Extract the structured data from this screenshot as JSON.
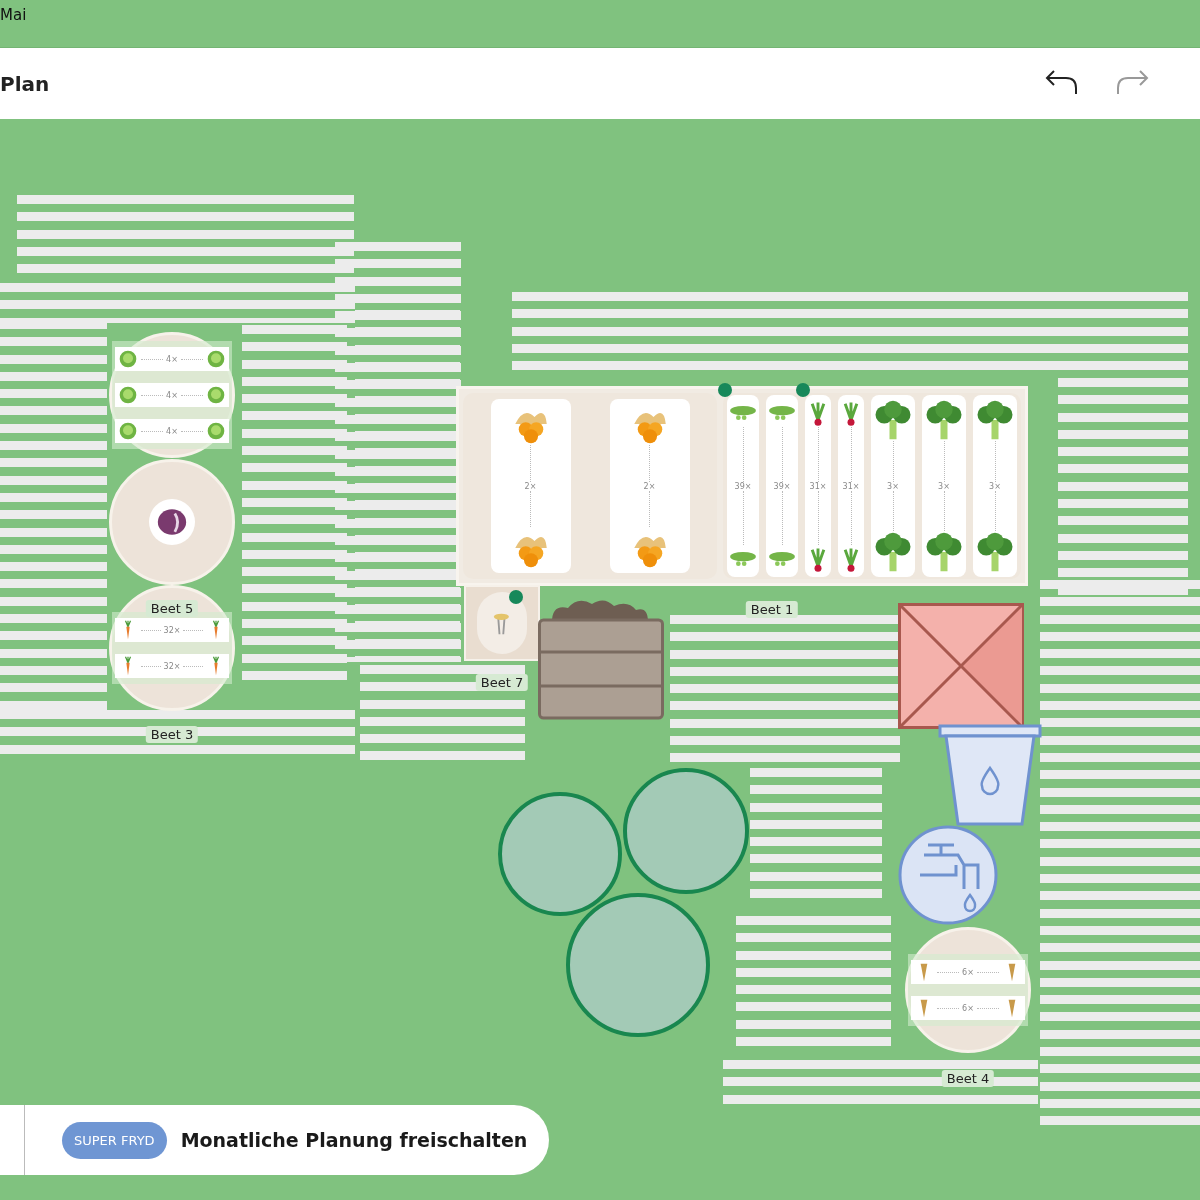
{
  "top_bar": {
    "month": "Mai"
  },
  "toolbar": {
    "title": "Plan",
    "undo": {
      "disabled": false
    },
    "redo": {
      "disabled": true
    }
  },
  "beds": [
    {
      "label": "Beet 5",
      "parts": [
        {
          "kind": "circle",
          "rows": [
            {
              "kind": "lettuce",
              "count": "4×"
            },
            {
              "kind": "lettuce",
              "count": "4×"
            },
            {
              "kind": "lettuce",
              "count": "4×"
            }
          ]
        },
        {
          "kind": "circle",
          "center": {
            "kind": "red_cabbage"
          }
        }
      ]
    },
    {
      "label": "Beet 3",
      "parts": [
        {
          "kind": "circle",
          "rows": [
            {
              "kind": "carrot",
              "count": "32×"
            },
            {
              "kind": "carrot",
              "count": "32×"
            }
          ]
        }
      ]
    },
    {
      "label": "Beet 1",
      "parts": [
        {
          "kind": "rect",
          "sections": [
            {
              "columns": [
                {
                  "kind": "physalis",
                  "count": "2×",
                  "pinned": false
                },
                {
                  "kind": "physalis",
                  "count": "2×",
                  "pinned": false
                }
              ]
            },
            {
              "columns": [
                {
                  "kind": "pea",
                  "count": "39×",
                  "pinned": true
                },
                {
                  "kind": "pea",
                  "count": "39×",
                  "pinned": false
                },
                {
                  "kind": "radish",
                  "count": "31×",
                  "pinned": true
                },
                {
                  "kind": "radish",
                  "count": "31×",
                  "pinned": false
                },
                {
                  "kind": "broccoli",
                  "count": "3×",
                  "pinned": false
                },
                {
                  "kind": "broccoli",
                  "count": "3×",
                  "pinned": false
                },
                {
                  "kind": "broccoli",
                  "count": "3×",
                  "pinned": false
                }
              ]
            }
          ]
        }
      ]
    },
    {
      "label": "Beet 7",
      "parts": [
        {
          "kind": "square",
          "center": {
            "kind": "mushroom"
          },
          "pinned": true
        }
      ]
    },
    {
      "label": "Beet 4",
      "parts": [
        {
          "kind": "circle",
          "rows": [
            {
              "kind": "parsnip",
              "count": "6×"
            },
            {
              "kind": "parsnip",
              "count": "6×"
            }
          ]
        }
      ]
    }
  ],
  "objects": [
    {
      "kind": "compost"
    },
    {
      "kind": "shed"
    },
    {
      "kind": "barrel"
    },
    {
      "kind": "tap"
    },
    {
      "kind": "tree"
    },
    {
      "kind": "tree"
    },
    {
      "kind": "tree"
    }
  ],
  "banner": {
    "badge": "SUPER FRYD",
    "text": "Monatliche Planung freischalten"
  }
}
